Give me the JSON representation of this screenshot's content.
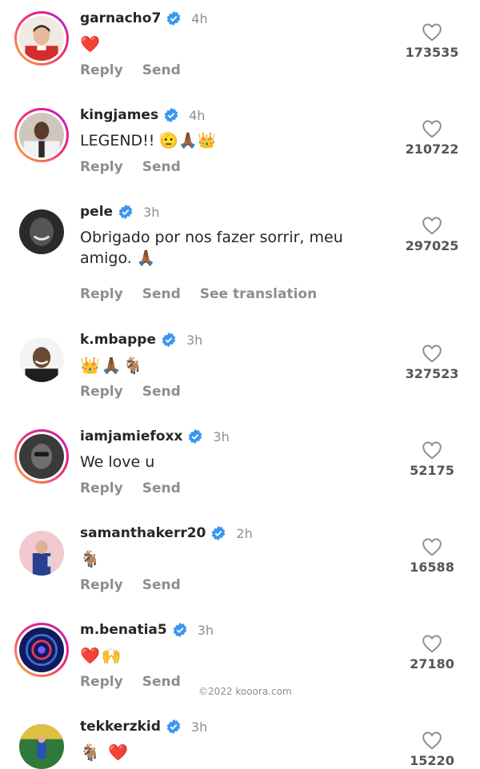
{
  "labels": {
    "reply": "Reply",
    "send": "Send",
    "see_translation": "See translation"
  },
  "comments": [
    {
      "username": "garnacho7",
      "time": "4h",
      "text": "❤️",
      "likes": "173535"
    },
    {
      "username": "kingjames",
      "time": "4h",
      "text": "LEGEND!! 🫡🙏🏾👑",
      "likes": "210722"
    },
    {
      "username": "pele",
      "time": "3h",
      "text": "Obrigado por nos fazer sorrir, meu amigo. 🙏🏾",
      "likes": "297025"
    },
    {
      "username": "k.mbappe",
      "time": "3h",
      "text": "👑🙏🏾🐐",
      "likes": "327523"
    },
    {
      "username": "iamjamiefoxx",
      "time": "3h",
      "text": "We love u",
      "likes": "52175"
    },
    {
      "username": "samanthakerr20",
      "time": "2h",
      "text": "🐐",
      "likes": "16588"
    },
    {
      "username": "m.benatia5",
      "time": "3h",
      "text": "❤️🙌",
      "likes": "27180"
    },
    {
      "username": "tekkerzkid",
      "time": "3h",
      "text": "🐐 ❤️",
      "likes": "15220"
    }
  ],
  "watermark": "©2022 kooora.com",
  "colors": {
    "verified": "#3897f0",
    "muted": "#8e8e8e",
    "text": "#262626"
  }
}
